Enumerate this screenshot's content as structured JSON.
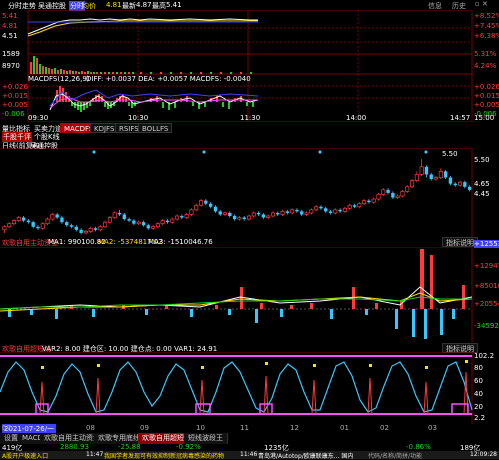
{
  "header": {
    "title": "分时走势",
    "stock_name": "吴通控股",
    "tag1": "分时",
    "tag2": "均价",
    "price": "4.81",
    "vol_label": "最新",
    "vol_price": "4.87",
    "avg_label": "最高",
    "avg_price": "5.41"
  },
  "top_right": {
    "label1": "信息",
    "label2": "历史"
  },
  "intraday": {
    "y_labels_left": [
      "5.41",
      "4.81",
      "4.51"
    ],
    "y_labels_right": [
      "+8.52%",
      "+7.45%",
      "+6.38%"
    ],
    "vol_labels_left": [
      "1589",
      "8970"
    ],
    "vol_labels_right": [
      "5.31%",
      "4.24%"
    ],
    "time_labels": [
      "09:30",
      "10:30",
      "11:30",
      "14:00",
      "14:57",
      "15:00"
    ],
    "macd_title": "MACDFS(12,26,9)",
    "macd_values": "DIFF: +0.0037  DEA: +0.0057  MACDFS: -0.0040",
    "macd_left": [
      "+0.026",
      "+0.015",
      "+0.005",
      "-0.006"
    ],
    "macd_right": [
      "+0.026",
      "+0.015",
      "+0.005",
      "-0.006"
    ]
  },
  "indicator_tabs": {
    "left_labels": [
      "量比指标",
      "买卖力道",
      "千股千评",
      "个股K线"
    ],
    "buttons": [
      "MACDFS",
      "KDJFS",
      "RSIFS",
      "BOLLFS"
    ]
  },
  "kline": {
    "label": "日线(前复权)",
    "stock": "吴通控股",
    "high_label": "5.50",
    "right_labels": [
      "5.50",
      "4.65"
    ],
    "price_marker": "4.45"
  },
  "indicator1": {
    "title": "欢歌自用主动资金",
    "ma1": "MA1: 990100.82",
    "ma2": "MA2: -5374817.02",
    "ma3": "MA3: -1510046.76",
    "button": "指标说明",
    "right_labels": [
      "+1255180",
      "+129477",
      "+85010",
      "+20554",
      "-34592"
    ]
  },
  "indicator2": {
    "title": "欢歌自用超短线",
    "values": "VAR2: 8.00   建仓区: 10.00   建仓点: 0.00   VAR1: 24.91",
    "button": "指标说明",
    "right_labels": [
      "102.2",
      "80",
      "60",
      "40",
      "20",
      "2.2"
    ]
  },
  "date_bar": {
    "date": "2021-07-26",
    "weekday": "一",
    "months": [
      "07",
      "08",
      "09",
      "10",
      "11",
      "12",
      "01",
      "02",
      "03"
    ]
  },
  "bottom_tabs": [
    "设置",
    "MACD",
    "欢歌自用主动资金",
    "欢歌专用底线",
    "欢歌自用超短线",
    "短线波段王"
  ],
  "ticker": {
    "item1": "419亿",
    "item2": "2880.93",
    "item3": "-25.88",
    "item4": "-0.92%",
    "item5": "1235亿",
    "item6": "-0.86%",
    "item7": "189亿"
  },
  "news": {
    "prefix": "A股开户极速入口",
    "time1": "11:47",
    "headline1": "我国学者发现可有效抑制新冠病毒感染的药物",
    "time2": "11:46",
    "headline2": "青岛港/Autotop/欧康联康东... 国内",
    "search_label": "代码/名称/简拼/功能",
    "clock": "12:09:28"
  },
  "kline_data": {
    "candles": [
      [
        3.2,
        3.3,
        3.1,
        3.35
      ],
      [
        3.3,
        3.4,
        3.25,
        3.45
      ],
      [
        3.4,
        3.5,
        3.35,
        3.55
      ],
      [
        3.5,
        3.6,
        3.45,
        3.65
      ],
      [
        3.6,
        3.5,
        3.45,
        3.65
      ],
      [
        3.5,
        3.45,
        3.4,
        3.55
      ],
      [
        3.45,
        3.3,
        3.25,
        3.5
      ],
      [
        3.3,
        3.25,
        3.2,
        3.35
      ],
      [
        3.25,
        3.4,
        3.2,
        3.45
      ],
      [
        3.4,
        3.55,
        3.35,
        3.6
      ],
      [
        3.55,
        3.7,
        3.5,
        3.75
      ],
      [
        3.7,
        3.6,
        3.55,
        3.75
      ],
      [
        3.6,
        3.45,
        3.4,
        3.65
      ],
      [
        3.45,
        3.35,
        3.3,
        3.5
      ],
      [
        3.35,
        3.3,
        3.25,
        3.4
      ],
      [
        3.3,
        3.2,
        3.15,
        3.35
      ],
      [
        3.2,
        3.1,
        3.05,
        3.25
      ],
      [
        3.1,
        3.15,
        3.05,
        3.2
      ],
      [
        3.15,
        3.25,
        3.1,
        3.3
      ],
      [
        3.25,
        3.2,
        3.15,
        3.3
      ],
      [
        3.2,
        3.3,
        3.15,
        3.35
      ],
      [
        3.3,
        3.45,
        3.25,
        3.5
      ],
      [
        3.45,
        3.6,
        3.4,
        3.65
      ],
      [
        3.6,
        3.75,
        3.55,
        3.8
      ],
      [
        3.75,
        3.7,
        3.65,
        3.85
      ],
      [
        3.7,
        3.55,
        3.5,
        3.75
      ],
      [
        3.55,
        3.5,
        3.45,
        3.6
      ],
      [
        3.5,
        3.4,
        3.35,
        3.55
      ],
      [
        3.4,
        3.45,
        3.35,
        3.5
      ],
      [
        3.45,
        3.35,
        3.3,
        3.5
      ],
      [
        3.35,
        3.25,
        3.2,
        3.4
      ],
      [
        3.25,
        3.3,
        3.2,
        3.35
      ],
      [
        3.3,
        3.4,
        3.25,
        3.45
      ],
      [
        3.4,
        3.5,
        3.35,
        3.55
      ],
      [
        3.5,
        3.45,
        3.4,
        3.55
      ],
      [
        3.45,
        3.55,
        3.4,
        3.6
      ],
      [
        3.55,
        3.65,
        3.5,
        3.7
      ],
      [
        3.65,
        3.6,
        3.55,
        3.7
      ],
      [
        3.6,
        3.7,
        3.55,
        3.75
      ],
      [
        3.7,
        3.85,
        3.65,
        3.9
      ],
      [
        3.85,
        4.0,
        3.8,
        4.05
      ],
      [
        4.0,
        4.15,
        3.95,
        4.2
      ],
      [
        4.15,
        4.05,
        4.0,
        4.2
      ],
      [
        4.05,
        3.95,
        3.9,
        4.1
      ],
      [
        3.95,
        3.8,
        3.75,
        4.0
      ],
      [
        3.8,
        3.7,
        3.65,
        3.85
      ],
      [
        3.7,
        3.75,
        3.65,
        3.8
      ],
      [
        3.75,
        3.65,
        3.6,
        3.8
      ],
      [
        3.65,
        3.55,
        3.5,
        3.7
      ],
      [
        3.55,
        3.6,
        3.5,
        3.65
      ],
      [
        3.6,
        3.55,
        3.5,
        3.65
      ],
      [
        3.55,
        3.65,
        3.5,
        3.7
      ],
      [
        3.65,
        3.75,
        3.6,
        3.8
      ],
      [
        3.75,
        3.7,
        3.65,
        3.8
      ],
      [
        3.7,
        3.6,
        3.55,
        3.75
      ],
      [
        3.6,
        3.65,
        3.55,
        3.7
      ],
      [
        3.65,
        3.75,
        3.6,
        3.8
      ],
      [
        3.75,
        3.7,
        3.65,
        3.8
      ],
      [
        3.7,
        3.8,
        3.65,
        3.85
      ],
      [
        3.8,
        3.75,
        3.7,
        3.85
      ],
      [
        3.75,
        3.85,
        3.7,
        3.9
      ],
      [
        3.85,
        3.8,
        3.75,
        3.9
      ],
      [
        3.8,
        3.7,
        3.65,
        3.85
      ],
      [
        3.7,
        3.75,
        3.65,
        3.8
      ],
      [
        3.75,
        3.85,
        3.7,
        3.9
      ],
      [
        3.85,
        3.95,
        3.8,
        4.0
      ],
      [
        3.95,
        3.9,
        3.85,
        4.0
      ],
      [
        3.9,
        3.8,
        3.75,
        3.95
      ],
      [
        3.8,
        3.75,
        3.7,
        3.85
      ],
      [
        3.75,
        3.85,
        3.7,
        3.9
      ],
      [
        3.85,
        3.8,
        3.75,
        3.9
      ],
      [
        3.8,
        3.9,
        3.75,
        3.95
      ],
      [
        3.9,
        4.0,
        3.85,
        4.05
      ],
      [
        4.0,
        3.95,
        3.9,
        4.05
      ],
      [
        3.95,
        4.05,
        3.9,
        4.1
      ],
      [
        4.05,
        4.15,
        4.0,
        4.2
      ],
      [
        4.15,
        4.1,
        4.05,
        4.2
      ],
      [
        4.1,
        4.2,
        4.05,
        4.25
      ],
      [
        4.2,
        4.35,
        4.15,
        4.4
      ],
      [
        4.35,
        4.5,
        4.3,
        4.55
      ],
      [
        4.5,
        4.4,
        4.35,
        4.55
      ],
      [
        4.4,
        4.25,
        4.2,
        4.45
      ],
      [
        4.25,
        4.3,
        4.2,
        4.35
      ],
      [
        4.3,
        4.45,
        4.25,
        4.5
      ],
      [
        4.45,
        4.6,
        4.4,
        4.65
      ],
      [
        4.6,
        4.8,
        4.55,
        4.85
      ],
      [
        4.8,
        5.0,
        4.75,
        5.1
      ],
      [
        5.0,
        5.25,
        4.95,
        5.5
      ],
      [
        5.25,
        5.0,
        4.9,
        5.3
      ],
      [
        5.0,
        4.85,
        4.8,
        5.05
      ],
      [
        4.85,
        4.9,
        4.8,
        4.95
      ],
      [
        4.9,
        5.1,
        4.85,
        5.2
      ],
      [
        5.1,
        4.9,
        4.85,
        5.15
      ],
      [
        4.9,
        4.7,
        4.65,
        4.95
      ],
      [
        4.7,
        4.65,
        4.6,
        4.75
      ],
      [
        4.65,
        4.75,
        4.6,
        4.8
      ],
      [
        4.75,
        4.6,
        4.55,
        4.8
      ],
      [
        4.6,
        4.5,
        4.45,
        4.65
      ]
    ]
  }
}
